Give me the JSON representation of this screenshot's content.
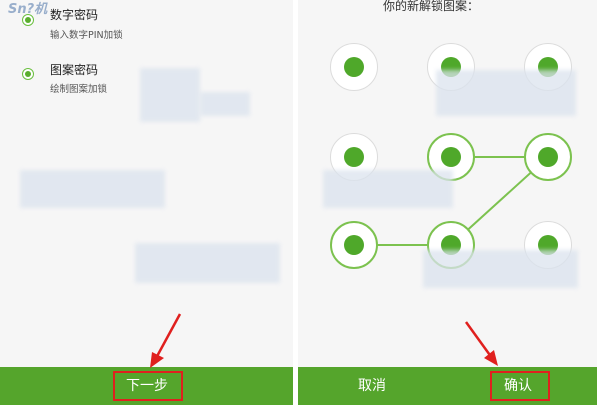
{
  "left": {
    "options": [
      {
        "title": "数字密码",
        "subtitle": "输入数字PIN加锁"
      },
      {
        "title": "图案密码",
        "subtitle": "绘制图案加锁"
      }
    ],
    "next_button": "下一步"
  },
  "right": {
    "pattern_title": "你的新解锁图案：",
    "cancel_button": "取消",
    "confirm_button": "确认",
    "selected_dots": [
      5,
      6,
      8,
      7
    ],
    "pattern_color": "#5aae2e"
  },
  "watermark": "Sn?机",
  "colors": {
    "accent": "#55a52c",
    "highlight": "#e0201e",
    "arrow": "#e0201e"
  }
}
